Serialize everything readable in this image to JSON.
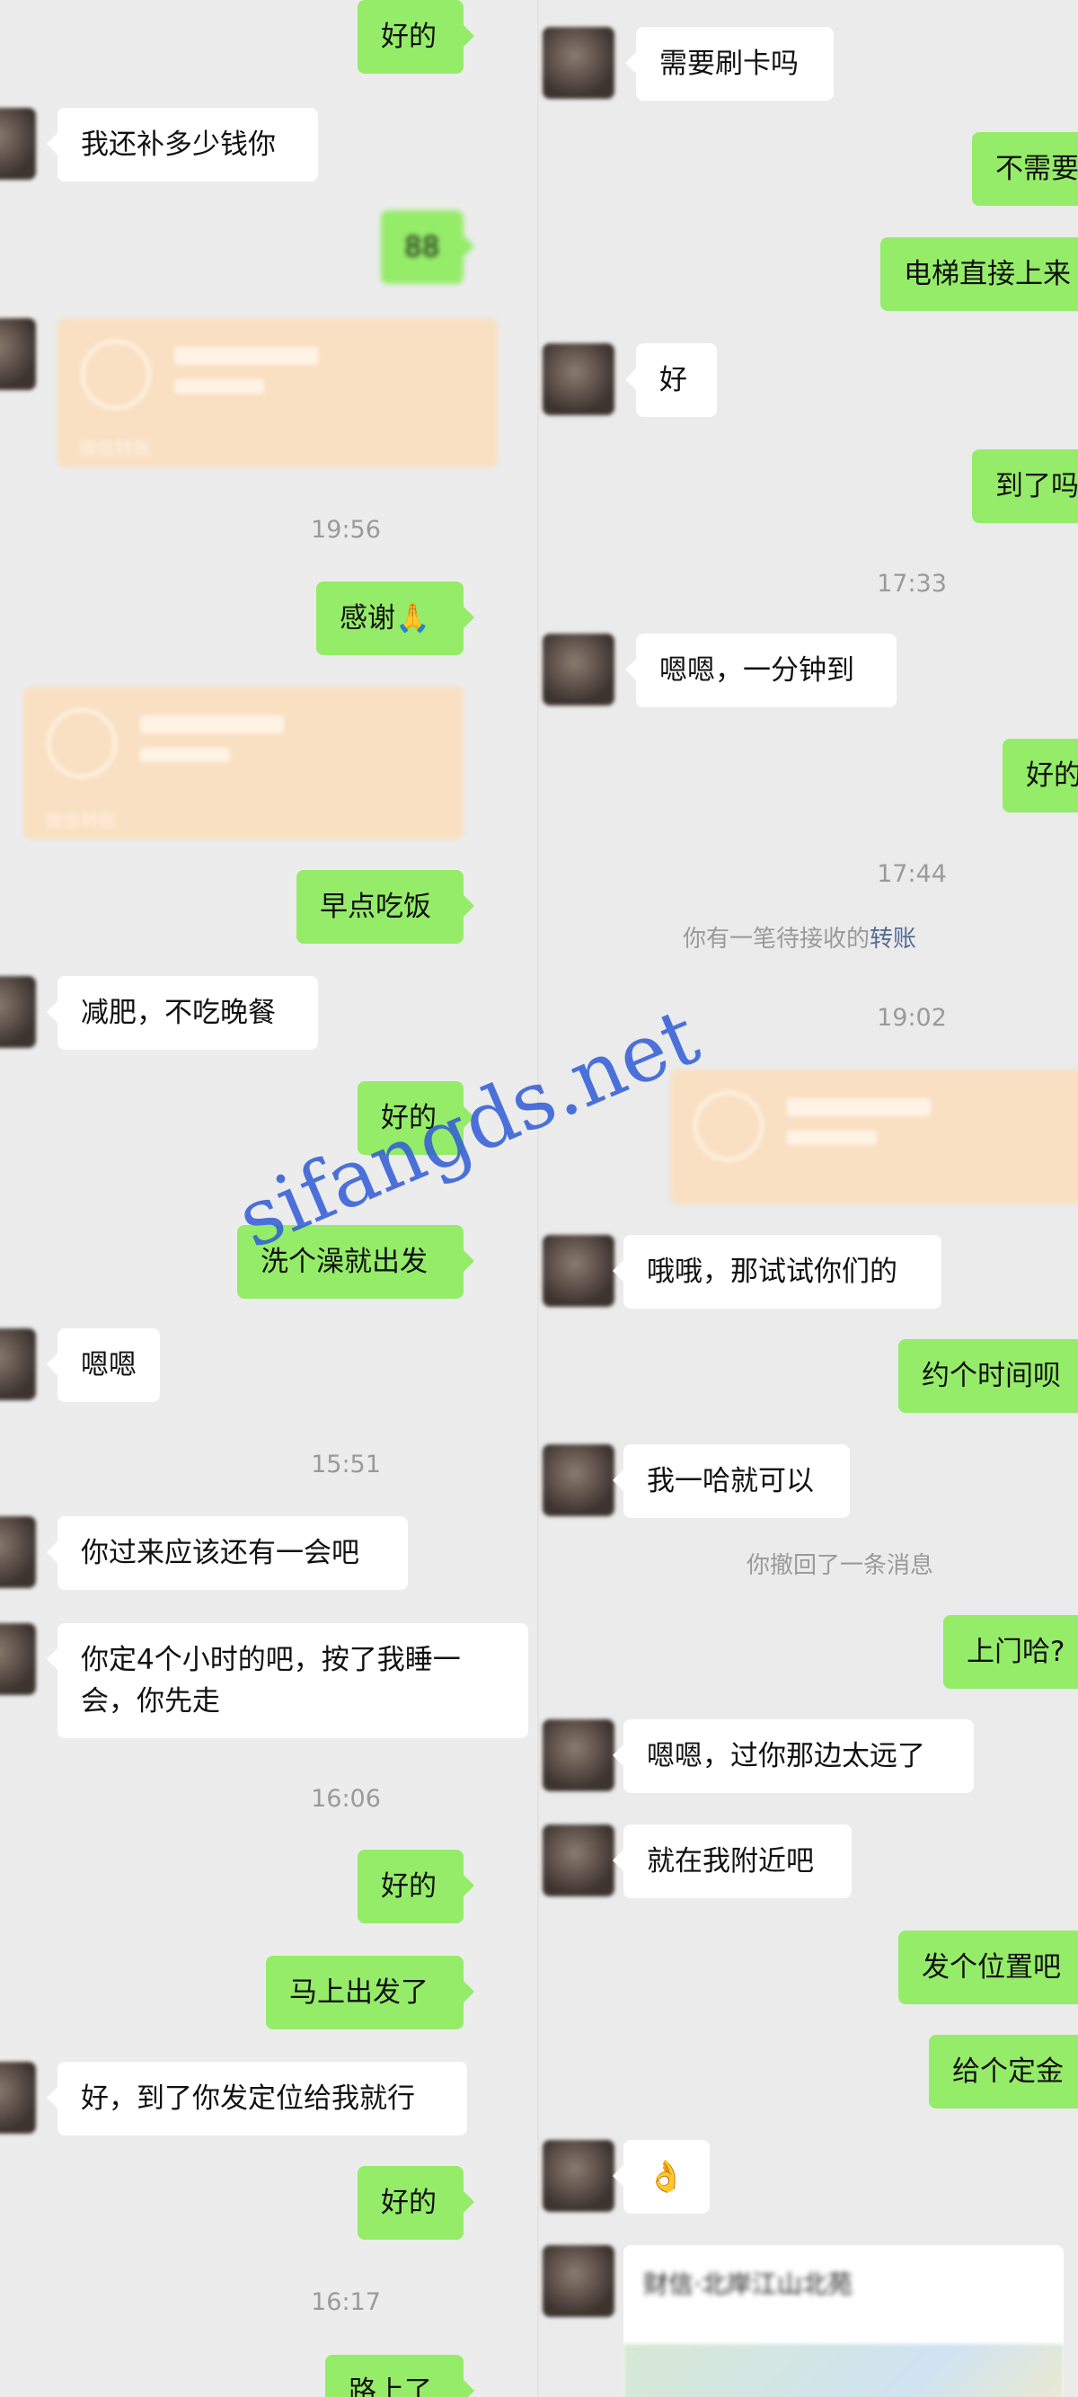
{
  "left_column": {
    "messages": [
      {
        "text": "好的"
      },
      {
        "text": "我还补多少钱你"
      },
      {
        "text": "88"
      },
      {
        "footer": "微信转账"
      },
      {
        "timestamp": "19:56"
      },
      {
        "text": "感谢🙏"
      },
      {
        "footer": "微信转账"
      },
      {
        "text": "早点吃饭"
      },
      {
        "text": "减肥，不吃晚餐"
      },
      {
        "text": "好的"
      },
      {
        "text": "洗个澡就出发"
      },
      {
        "text": "嗯嗯"
      },
      {
        "timestamp": "15:51"
      },
      {
        "text": "你过来应该还有一会吧"
      },
      {
        "text": "你定4个小时的吧，按了我睡一会，你先走"
      },
      {
        "timestamp": "16:06"
      },
      {
        "text": "好的"
      },
      {
        "text": "马上出发了"
      },
      {
        "text": "好，到了你发定位给我就行"
      },
      {
        "text": "好的"
      },
      {
        "timestamp": "16:17"
      },
      {
        "text": "路上了"
      }
    ]
  },
  "right_column": {
    "messages": [
      {
        "text": "需要刷卡吗"
      },
      {
        "text": "不需要"
      },
      {
        "text": "电梯直接上来"
      },
      {
        "text": "好"
      },
      {
        "text": "到了吗"
      },
      {
        "timestamp": "17:33"
      },
      {
        "text": "嗯嗯，一分钟到"
      },
      {
        "text": "好的"
      },
      {
        "timestamp": "17:44"
      },
      {
        "system_prefix": "你有一笔待接收的",
        "system_link": "转账"
      },
      {
        "timestamp": "19:02"
      },
      {
        "text": "哦哦，那试试你们的"
      },
      {
        "text": "约个时间呗"
      },
      {
        "text": "我一哈就可以"
      },
      {
        "system": "你撤回了一条消息"
      },
      {
        "text": "上门哈?"
      },
      {
        "text": "嗯嗯，过你那边太远了"
      },
      {
        "text": "就在我附近吧"
      },
      {
        "text": "发个位置吧"
      },
      {
        "text": "给个定金"
      },
      {
        "text": "👌"
      },
      {
        "title": "财信·北岸江山北苑"
      }
    ]
  },
  "watermark": "sifangds.net",
  "colors": {
    "outgoing_bubble": "#95ec69",
    "incoming_bubble": "#ffffff",
    "transfer_card": "#f9e0c2",
    "link": "#576b95",
    "watermark": "#2f5bd6"
  }
}
